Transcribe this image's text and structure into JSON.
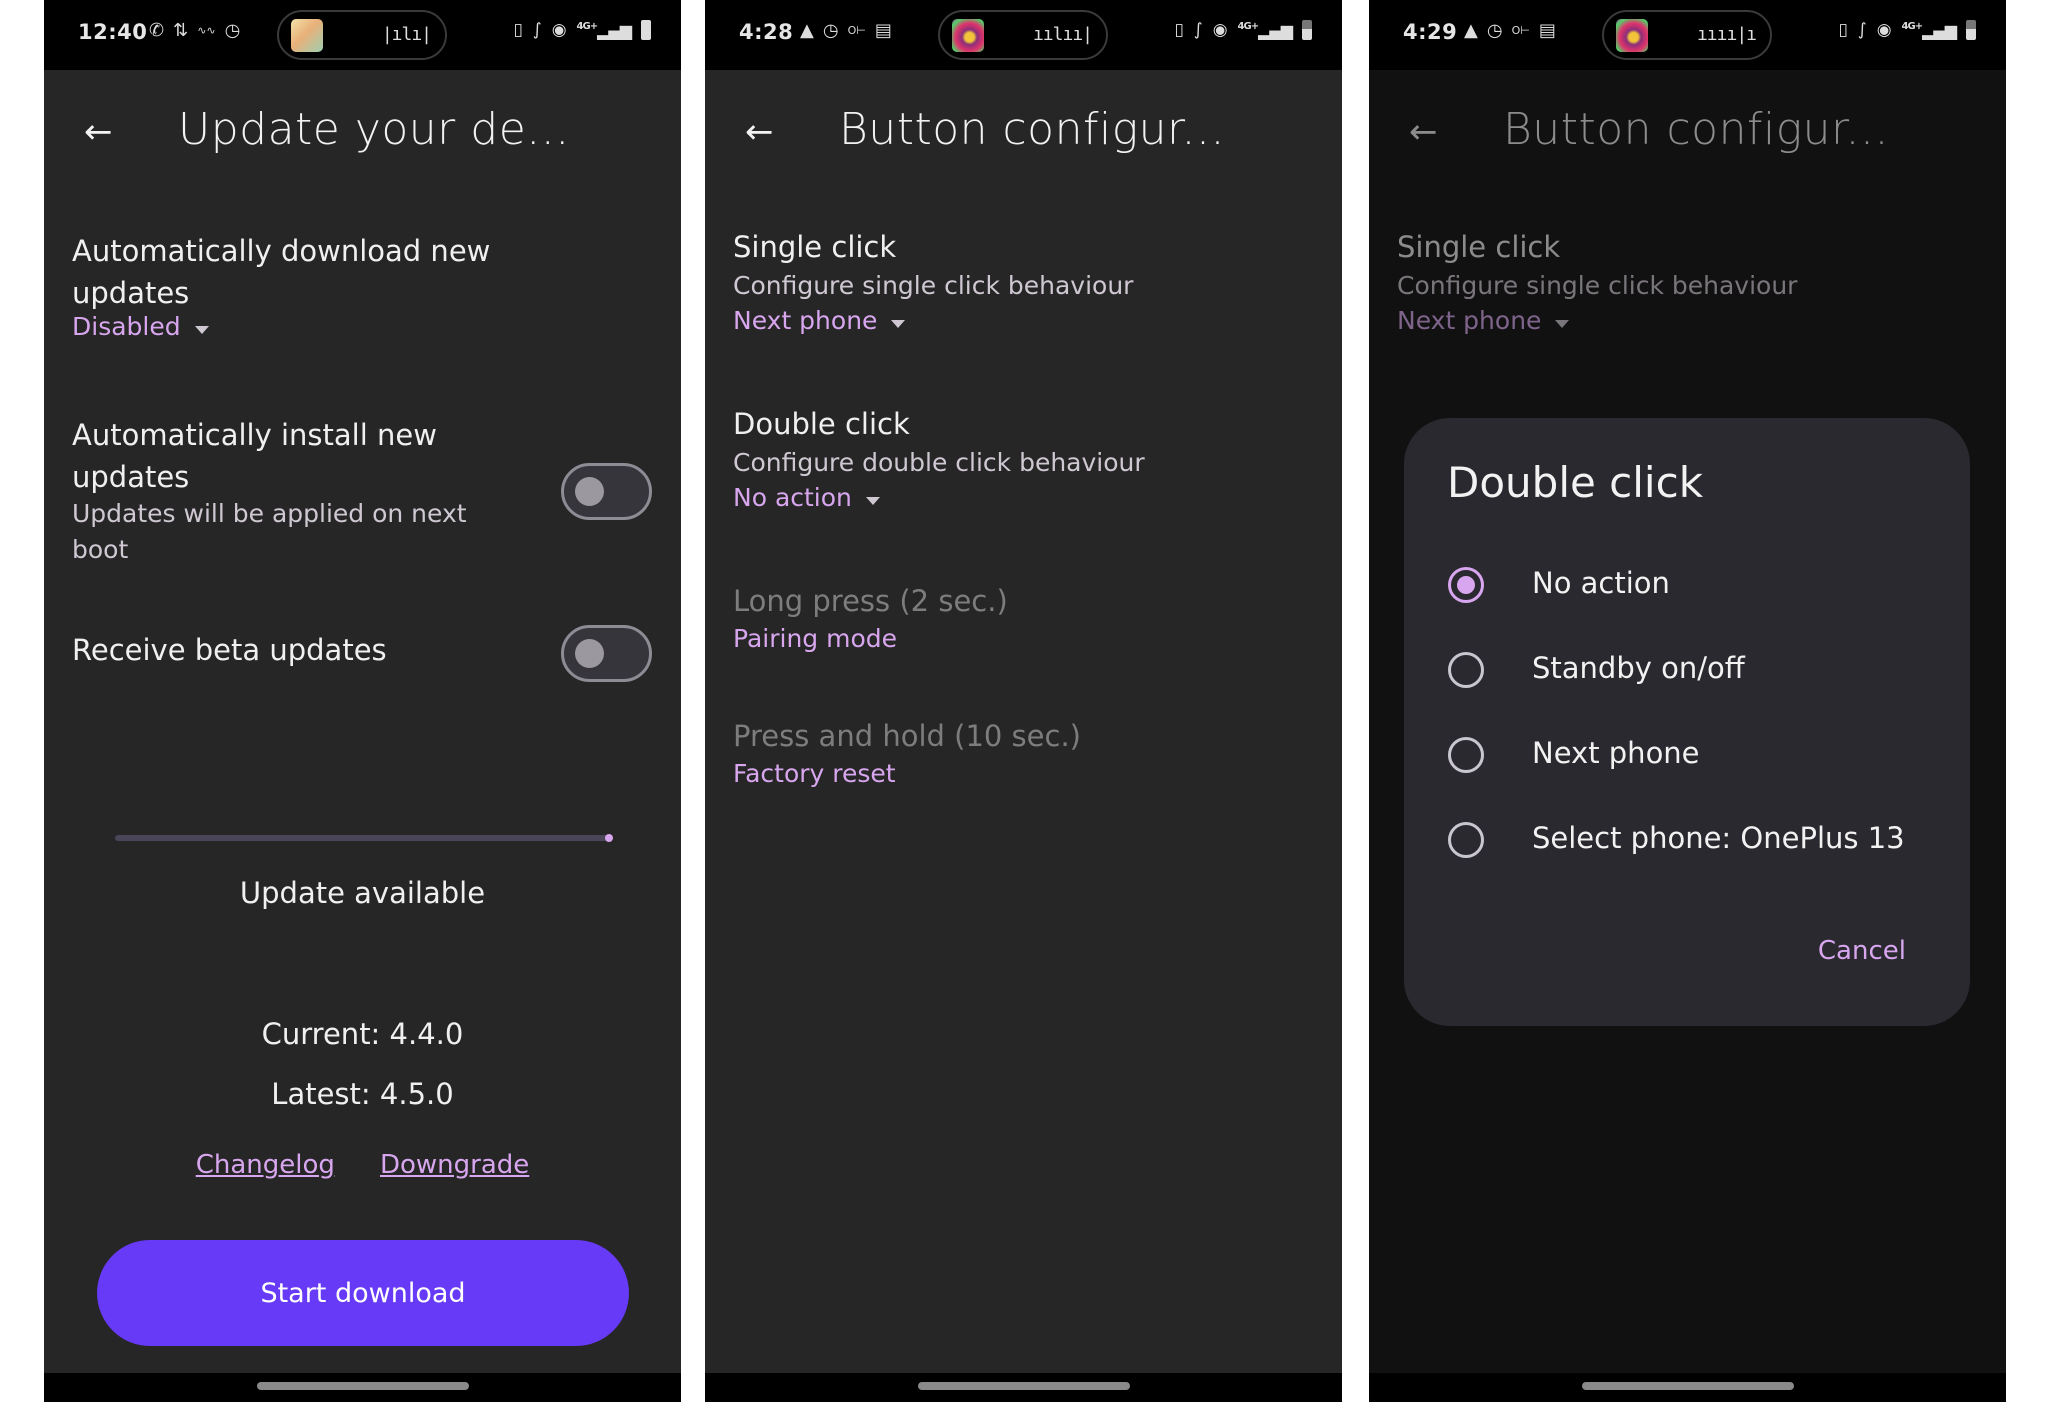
{
  "colors": {
    "accent": "#d7a6ee",
    "primary_button": "#663af6",
    "surface": "#262626",
    "dialog_surface": "#2a2930"
  },
  "screens": [
    {
      "status_bar": {
        "time": "12:40",
        "left_icons": [
          "whatsapp-icon",
          "sync-icon",
          "wave-icon",
          "alarm-icon"
        ],
        "right_icons": [
          "vibrate-icon",
          "bluetooth-icon",
          "location-icon",
          "signal-4g-icon",
          "battery-icon"
        ],
        "network": "4G+"
      },
      "header": {
        "back_icon": "arrow-left-icon",
        "title": "Update your de..."
      },
      "settings": [
        {
          "title": "Automatically download new updates",
          "value": "Disabled",
          "type": "dropdown"
        },
        {
          "title": "Automatically install new updates",
          "subtitle": "Updates will be applied on next boot",
          "type": "toggle",
          "checked": false
        },
        {
          "title": "Receive beta updates",
          "type": "toggle",
          "checked": false
        }
      ],
      "update": {
        "progress": 0,
        "status": "Update available",
        "current": "Current: 4.4.0",
        "latest": "Latest: 4.5.0",
        "changelog_link": "Changelog",
        "downgrade_link": "Downgrade",
        "start_button": "Start download"
      }
    },
    {
      "status_bar": {
        "time": "4:28",
        "left_icons": [
          "android-auto-icon",
          "alarm-icon",
          "key-icon",
          "calendar-icon"
        ],
        "right_icons": [
          "vibrate-icon",
          "bluetooth-icon",
          "location-icon",
          "signal-4g-icon",
          "battery-icon"
        ],
        "network": "4G+"
      },
      "header": {
        "back_icon": "arrow-left-icon",
        "title": "Button configur..."
      },
      "buttons": [
        {
          "title": "Single click",
          "subtitle": "Configure single click behaviour",
          "value": "Next phone",
          "enabled": true
        },
        {
          "title": "Double click",
          "subtitle": "Configure double click behaviour",
          "value": "No action",
          "enabled": true
        },
        {
          "title": "Long press (2 sec.)",
          "value": "Pairing mode",
          "enabled": false
        },
        {
          "title": "Press and hold (10 sec.)",
          "value": "Factory reset",
          "enabled": false
        }
      ]
    },
    {
      "status_bar": {
        "time": "4:29",
        "left_icons": [
          "android-auto-icon",
          "alarm-icon",
          "key-icon",
          "calendar-icon"
        ],
        "right_icons": [
          "vibrate-icon",
          "bluetooth-icon",
          "location-icon",
          "signal-4g-icon",
          "battery-icon"
        ],
        "network": "4G+"
      },
      "header": {
        "back_icon": "arrow-left-icon",
        "title": "Button configur..."
      },
      "background": {
        "single_title": "Single click",
        "single_subtitle": "Configure single click behaviour",
        "single_value": "Next phone"
      },
      "dialog": {
        "title": "Double click",
        "options": [
          {
            "label": "No action",
            "selected": true
          },
          {
            "label": "Standby on/off",
            "selected": false
          },
          {
            "label": "Next phone",
            "selected": false
          },
          {
            "label": "Select phone: OnePlus 13",
            "selected": false
          }
        ],
        "cancel": "Cancel"
      }
    }
  ]
}
